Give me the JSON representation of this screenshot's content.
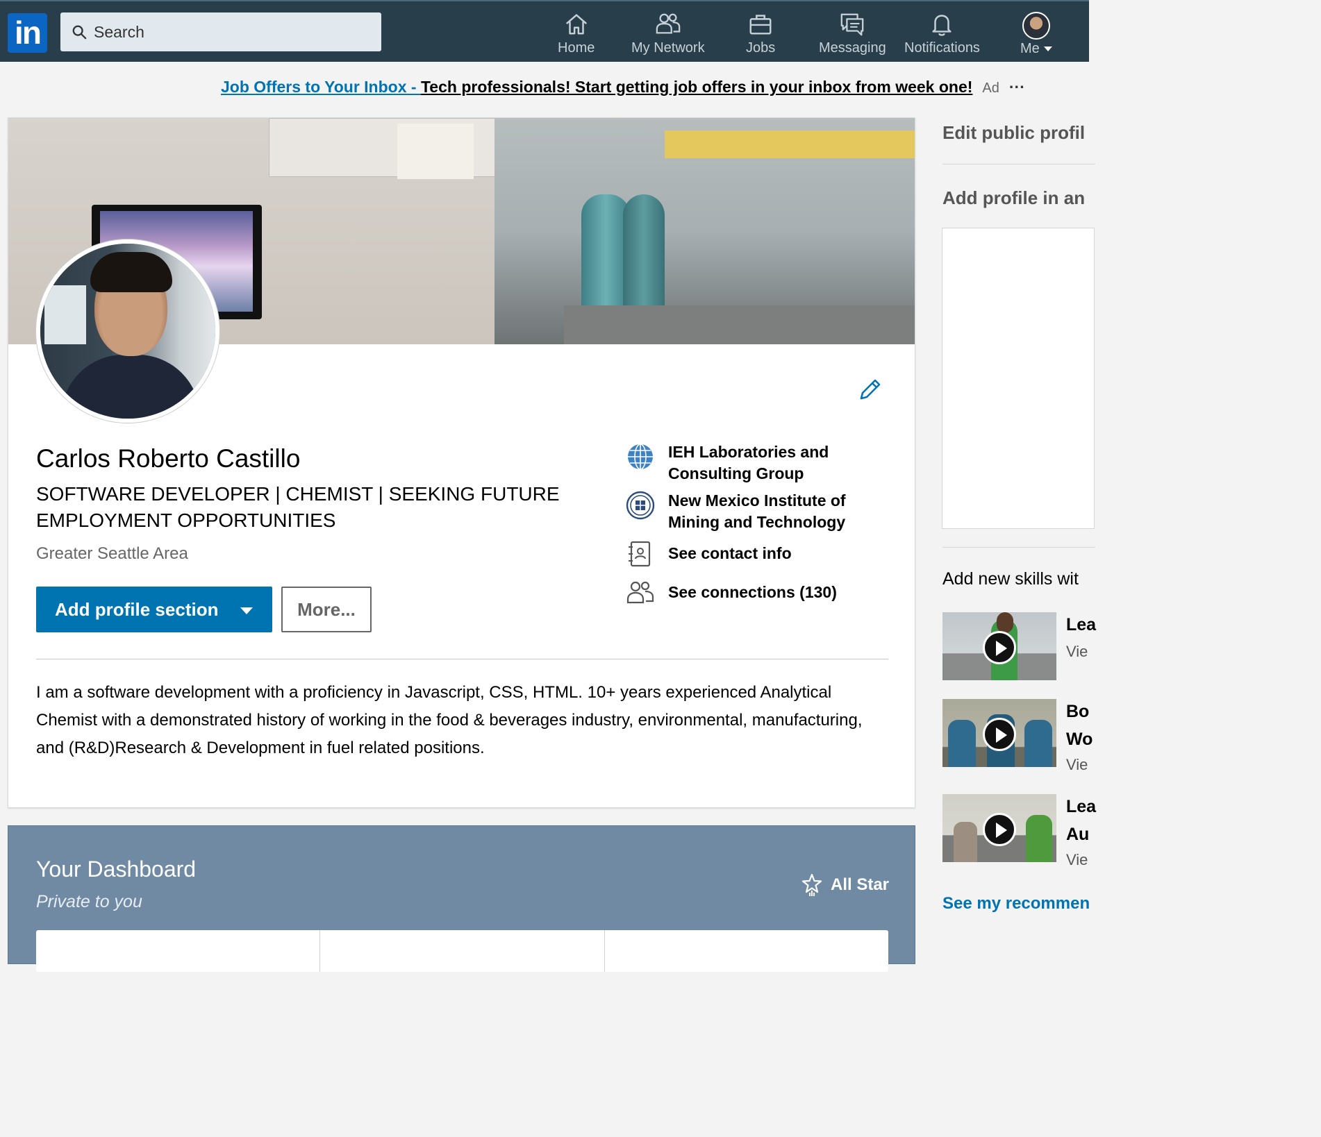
{
  "nav": {
    "logo": "in",
    "search_placeholder": "Search",
    "items": [
      {
        "label": "Home",
        "icon": "home-icon"
      },
      {
        "label": "My Network",
        "icon": "network-icon"
      },
      {
        "label": "Jobs",
        "icon": "briefcase-icon"
      },
      {
        "label": "Messaging",
        "icon": "messaging-icon"
      },
      {
        "label": "Notifications",
        "icon": "bell-icon"
      },
      {
        "label": "Me",
        "icon": "avatar"
      }
    ],
    "colors": {
      "bar": "#283e4a",
      "brand": "#0a66c2"
    }
  },
  "ad": {
    "link": "Job Offers to Your Inbox - ",
    "text": "Tech professionals! Start getting job offers in your inbox from week one!",
    "tag": "Ad",
    "more": "···"
  },
  "profile": {
    "name": "Carlos Roberto Castillo",
    "headline": "SOFTWARE DEVELOPER | CHEMIST | SEEKING FUTURE EMPLOYMENT OPPORTUNITIES",
    "location": "Greater Seattle Area",
    "add_section_label": "Add profile section",
    "more_label": "More...",
    "side": [
      {
        "label": "IEH Laboratories and Consulting Group",
        "icon": "company-globe-icon"
      },
      {
        "label": "New Mexico Institute of Mining and Technology",
        "icon": "school-seal-icon"
      },
      {
        "label": "See contact info",
        "icon": "contact-card-icon"
      },
      {
        "label": "See connections (130)",
        "icon": "connections-icon"
      }
    ],
    "summary": "I am a software development with a proficiency in Javascript, CSS, HTML. 10+ years experienced Analytical Chemist with a demonstrated history of working in the food & beverages industry, environmental, manufacturing, and (R&D)Research & Development in fuel related positions."
  },
  "dashboard": {
    "title": "Your Dashboard",
    "subtitle": "Private to you",
    "badge": "All Star",
    "color": "#6f8aa2"
  },
  "rail": {
    "edit_public": "Edit public profil",
    "add_language": "Add profile in an",
    "skills_title": "Add new skills wit",
    "courses": [
      {
        "line1": "Lea",
        "line2": "",
        "view": "Vie"
      },
      {
        "line1": "Bo",
        "line2": "Wo",
        "view": "Vie"
      },
      {
        "line1": "Lea",
        "line2": "Au",
        "view": "Vie"
      }
    ],
    "see_recs": "See my recommen"
  }
}
